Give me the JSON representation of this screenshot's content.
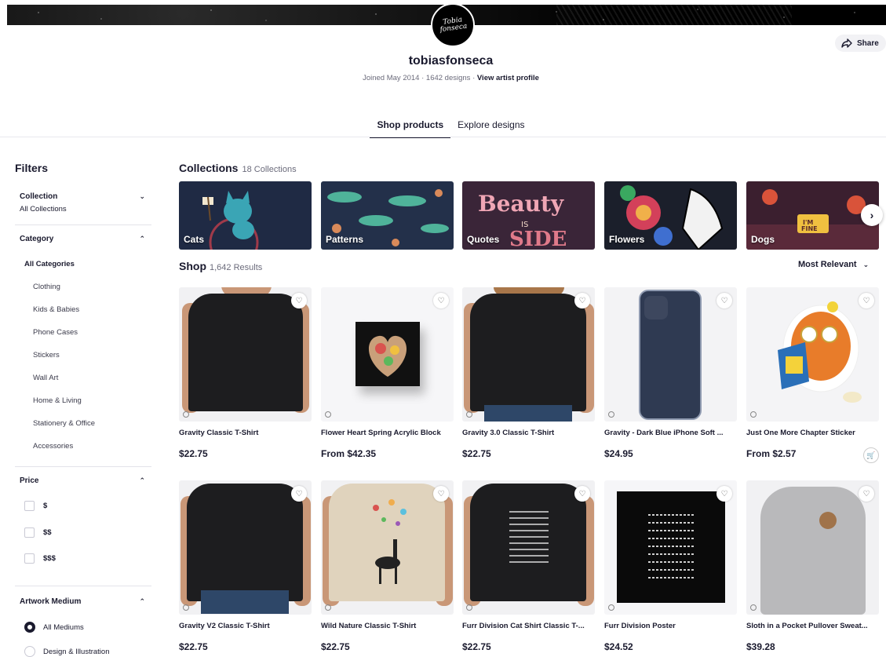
{
  "header": {
    "avatar_text": "Tobia\nfonseca",
    "artist_name": "tobiasfonseca",
    "joined": "Joined May 2014",
    "designs": "1642 designs",
    "view_profile": "View artist profile",
    "share_label": "Share"
  },
  "tabs": [
    {
      "label": "Shop products",
      "active": true
    },
    {
      "label": "Explore designs",
      "active": false
    }
  ],
  "sidebar": {
    "title": "Filters",
    "collection": {
      "label": "Collection",
      "value": "All Collections"
    },
    "category": {
      "label": "Category",
      "all": "All Categories",
      "items": [
        "Clothing",
        "Kids & Babies",
        "Phone Cases",
        "Stickers",
        "Wall Art",
        "Home & Living",
        "Stationery & Office",
        "Accessories"
      ]
    },
    "price": {
      "label": "Price",
      "options": [
        "$",
        "$$",
        "$$$"
      ]
    },
    "medium": {
      "label": "Artwork Medium",
      "options": [
        "All Mediums",
        "Design & Illustration"
      ],
      "selected": "All Mediums"
    }
  },
  "collections": {
    "title": "Collections",
    "count": "18 Collections",
    "items": [
      {
        "label": "Cats",
        "color": "#1f2a44"
      },
      {
        "label": "Patterns",
        "color": "#23304a"
      },
      {
        "label": "Quotes",
        "color": "#3a2538"
      },
      {
        "label": "Flowers",
        "color": "#1b1f2b"
      },
      {
        "label": "Dogs",
        "color": "#3b1f2f"
      }
    ]
  },
  "shop": {
    "title": "Shop",
    "count": "1,642 Results",
    "sort": "Most Relevant",
    "products": [
      {
        "title": "Gravity Classic T-Shirt",
        "price": "$22.75"
      },
      {
        "title": "Flower Heart Spring Acrylic Block",
        "price": "From $42.35"
      },
      {
        "title": "Gravity 3.0 Classic T-Shirt",
        "price": "$22.75"
      },
      {
        "title": "Gravity - Dark Blue iPhone Soft ...",
        "price": "$24.95"
      },
      {
        "title": "Just One More Chapter Sticker",
        "price": "From $2.57"
      },
      {
        "title": "Gravity V2 Classic T-Shirt",
        "price": "$22.75"
      },
      {
        "title": "Wild Nature Classic T-Shirt",
        "price": "$22.75"
      },
      {
        "title": "Furr Division Cat Shirt Classic T-...",
        "price": "$22.75"
      },
      {
        "title": "Furr Division Poster",
        "price": "$24.52"
      },
      {
        "title": "Sloth in a Pocket Pullover Sweat...",
        "price": "$39.28"
      }
    ]
  }
}
